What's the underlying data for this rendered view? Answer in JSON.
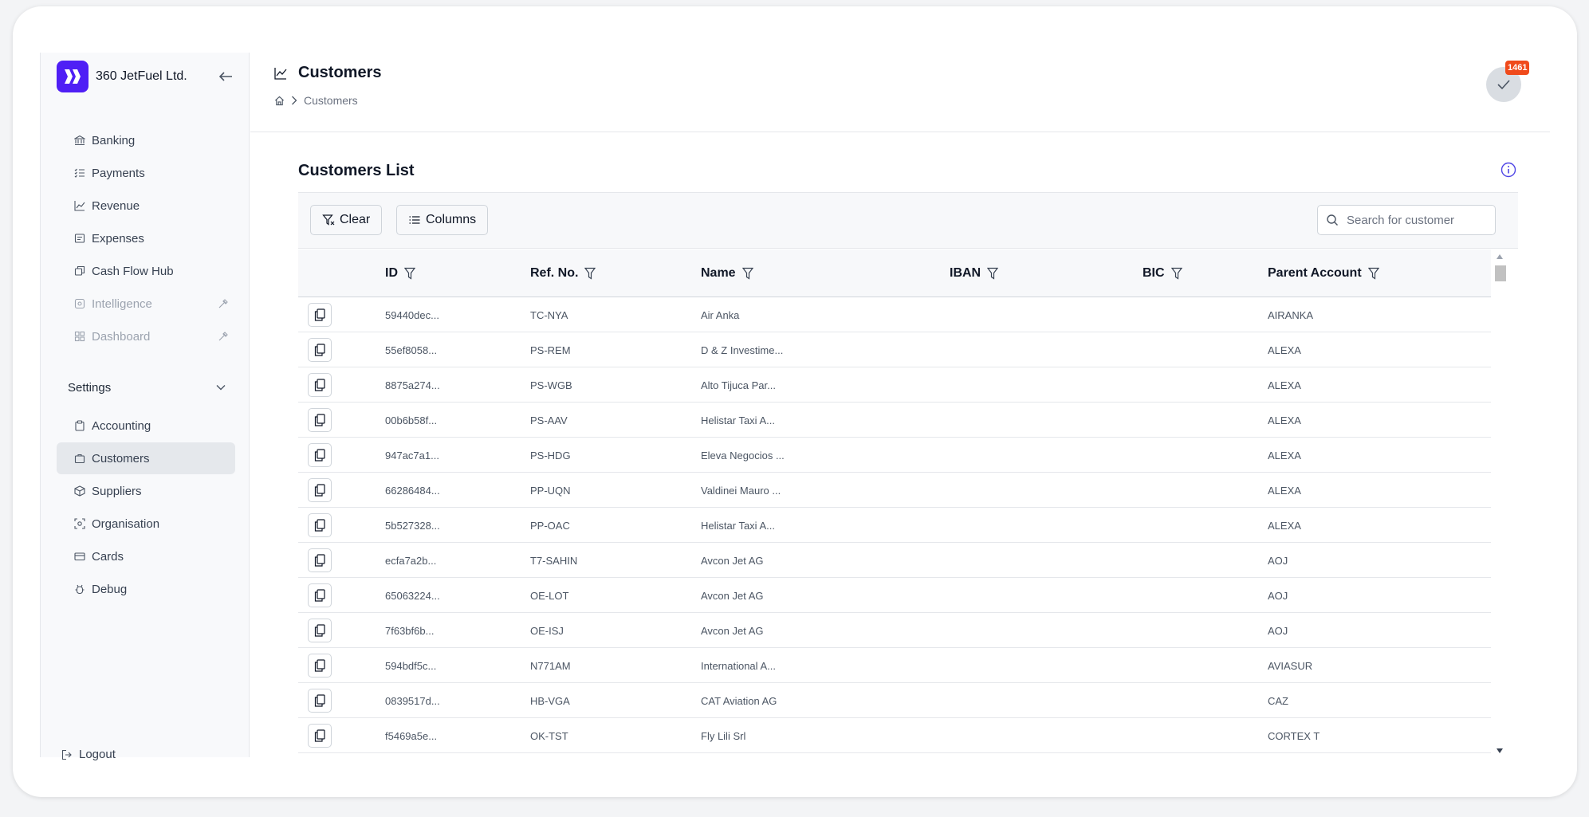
{
  "sidebar": {
    "brand": "360 JetFuel Ltd.",
    "items": [
      {
        "label": "Banking",
        "icon": "bank-icon",
        "disabled": false
      },
      {
        "label": "Payments",
        "icon": "list-check-icon",
        "disabled": false
      },
      {
        "label": "Revenue",
        "icon": "chart-line-icon",
        "disabled": false
      },
      {
        "label": "Expenses",
        "icon": "receipt-icon",
        "disabled": false
      },
      {
        "label": "Cash Flow Hub",
        "icon": "cash-flow-icon",
        "disabled": false
      },
      {
        "label": "Intelligence",
        "icon": "intelligence-icon",
        "disabled": true
      },
      {
        "label": "Dashboard",
        "icon": "dashboard-icon",
        "disabled": true
      }
    ],
    "settings_label": "Settings",
    "settings_items": [
      {
        "label": "Accounting",
        "icon": "clipboard-icon"
      },
      {
        "label": "Customers",
        "icon": "briefcase-icon",
        "active": true
      },
      {
        "label": "Suppliers",
        "icon": "package-icon"
      },
      {
        "label": "Organisation",
        "icon": "organisation-icon"
      },
      {
        "label": "Cards",
        "icon": "card-icon"
      },
      {
        "label": "Debug",
        "icon": "debug-icon"
      }
    ],
    "logout_label": "Logout"
  },
  "header": {
    "title": "Customers",
    "breadcrumb_current": "Customers",
    "badge_count": "1461"
  },
  "main": {
    "list_title": "Customers List",
    "clear_label": "Clear",
    "columns_label": "Columns",
    "search_placeholder": "Search for customer",
    "columns": [
      "ID",
      "Ref. No.",
      "Name",
      "IBAN",
      "BIC",
      "Parent Account"
    ],
    "rows": [
      {
        "id": "59440dec...",
        "ref": "TC-NYA",
        "name": "Air Anka",
        "iban": "",
        "bic": "",
        "parent": "AIRANKA"
      },
      {
        "id": "55ef8058...",
        "ref": "PS-REM",
        "name": "D & Z Investime...",
        "iban": "",
        "bic": "",
        "parent": "ALEXA"
      },
      {
        "id": "8875a274...",
        "ref": "PS-WGB",
        "name": "Alto Tijuca Par...",
        "iban": "",
        "bic": "",
        "parent": "ALEXA"
      },
      {
        "id": "00b6b58f...",
        "ref": "PS-AAV",
        "name": "Helistar Taxi A...",
        "iban": "",
        "bic": "",
        "parent": "ALEXA"
      },
      {
        "id": "947ac7a1...",
        "ref": "PS-HDG",
        "name": "Eleva Negocios ...",
        "iban": "",
        "bic": "",
        "parent": "ALEXA"
      },
      {
        "id": "66286484...",
        "ref": "PP-UQN",
        "name": "Valdinei Mauro ...",
        "iban": "",
        "bic": "",
        "parent": "ALEXA"
      },
      {
        "id": "5b527328...",
        "ref": "PP-OAC",
        "name": "Helistar Taxi A...",
        "iban": "",
        "bic": "",
        "parent": "ALEXA"
      },
      {
        "id": "ecfa7a2b...",
        "ref": "T7-SAHIN",
        "name": "Avcon Jet AG",
        "iban": "",
        "bic": "",
        "parent": "AOJ"
      },
      {
        "id": "65063224...",
        "ref": "OE-LOT",
        "name": "Avcon Jet AG",
        "iban": "",
        "bic": "",
        "parent": "AOJ"
      },
      {
        "id": "7f63bf6b...",
        "ref": "OE-ISJ",
        "name": "Avcon Jet AG",
        "iban": "",
        "bic": "",
        "parent": "AOJ"
      },
      {
        "id": "594bdf5c...",
        "ref": "N771AM",
        "name": "International A...",
        "iban": "",
        "bic": "",
        "parent": "AVIASUR"
      },
      {
        "id": "0839517d...",
        "ref": "HB-VGA",
        "name": "CAT Aviation AG",
        "iban": "",
        "bic": "",
        "parent": "CAZ"
      },
      {
        "id": "f5469a5e...",
        "ref": "OK-TST",
        "name": "Fly Lili Srl",
        "iban": "",
        "bic": "",
        "parent": "CORTEX T"
      }
    ]
  },
  "colors": {
    "brand": "#4f1ff5",
    "badge": "#f04a1b",
    "info": "#4f46e5"
  }
}
